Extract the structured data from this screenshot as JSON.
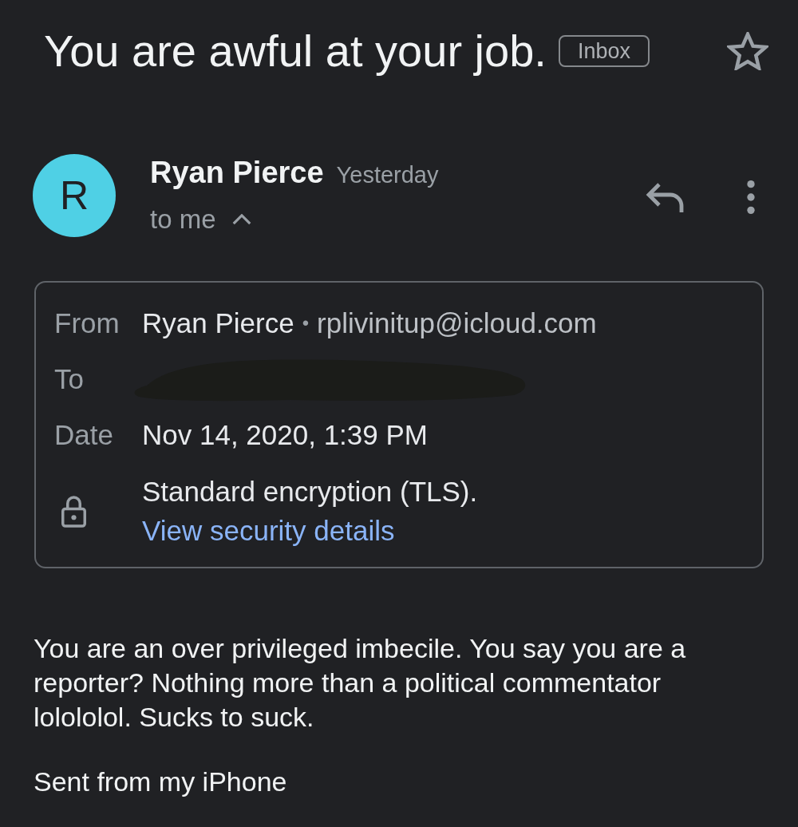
{
  "subject": {
    "title": "You are awful at your job.",
    "label": "Inbox",
    "starred": false
  },
  "message": {
    "avatar_letter": "R",
    "sender": "Ryan Pierce",
    "time": "Yesterday",
    "recipients": "to me",
    "details_expanded": true
  },
  "details": {
    "rows": [
      {
        "kind": "address",
        "label": "From",
        "name": "Ryan Pierce",
        "separator": "•",
        "email": "rplivinitup@icloud.com"
      },
      {
        "kind": "redacted",
        "label": "To"
      },
      {
        "kind": "text",
        "label": "Date",
        "value": "Nov 14, 2020, 1:39 PM"
      },
      {
        "kind": "security",
        "text": "Standard encryption (TLS).",
        "link": "View security details"
      }
    ]
  },
  "body": {
    "paragraphs": [
      "You are an over privileged imbecile. You say you are a reporter? Nothing more than a political commentator lolololol. Sucks to suck.",
      "Sent from my iPhone"
    ]
  }
}
